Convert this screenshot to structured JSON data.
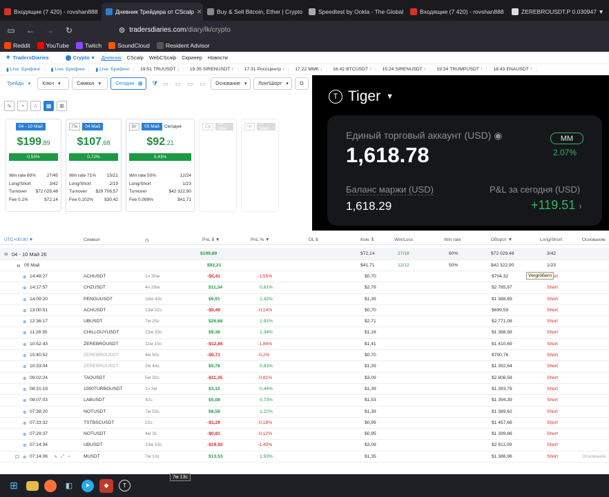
{
  "tabs": [
    {
      "label": "Входящие (7 420) - rovshan888",
      "color": "#d93025",
      "active": false
    },
    {
      "label": "Дневник Трейдера от CScalp",
      "color": "#2a7fd4",
      "active": true
    },
    {
      "label": "Buy & Sell Bitcoin, Ether | Crypto",
      "color": "#888",
      "active": false
    },
    {
      "label": "Speedtest by Ookla - The Global",
      "color": "#aaa",
      "active": false
    },
    {
      "label": "Входящие (7 420) - rovshan888",
      "color": "#d93025",
      "active": false
    },
    {
      "label": "ZEREBROUSDT.P 0.030947 ▼",
      "color": "#ddd",
      "active": false
    }
  ],
  "url": {
    "domain": "tradersdiaries.com",
    "path": "/diary/lk/crypto"
  },
  "bookmarks": [
    {
      "label": "Reddit",
      "color": "#ff4500"
    },
    {
      "label": "YouTube",
      "color": "#ff0000"
    },
    {
      "label": "Twitch",
      "color": "#9146ff"
    },
    {
      "label": "SoundCloud",
      "color": "#ff5500"
    },
    {
      "label": "Resident Advisor",
      "color": "#555"
    }
  ],
  "site": {
    "logo": "TradersDiaries",
    "market": "Crypto",
    "menu": [
      "Дневник",
      "CScalp",
      "WebCScalp",
      "Скринер",
      "Новости"
    ]
  },
  "ticker": [
    {
      "time": "Live: Брифинг",
      "name": "",
      "dir": "",
      "live": true
    },
    {
      "time": "Live: Брифинг",
      "name": "",
      "dir": "",
      "live": true
    },
    {
      "time": "Live: Брифинг",
      "name": "",
      "dir": "",
      "live": true
    },
    {
      "time": "19:51",
      "name": "TRUUSDT",
      "dir": "↓",
      "live": false
    },
    {
      "time": "19:35",
      "name": "SIRENUSDT",
      "dir": "↑",
      "live": false
    },
    {
      "time": "17:31",
      "name": "РоссЦентр",
      "dir": "↑",
      "live": false
    },
    {
      "time": "17:22",
      "name": "ММК",
      "dir": "↓",
      "live": false
    },
    {
      "time": "16:42",
      "name": "BTCUSDT",
      "dir": "↑",
      "live": false
    },
    {
      "time": "15:24",
      "name": "SIRENUSDT",
      "dir": "↑",
      "live": false
    },
    {
      "time": "19:34",
      "name": "TRUMPUSDT",
      "dir": "↑",
      "live": false
    },
    {
      "time": "18:43",
      "name": "ENAUSDT",
      "dir": "↑",
      "live": false
    }
  ],
  "filters": {
    "trades": "Трейды",
    "key": "Ключ",
    "symbol": "Символ",
    "today": "Сегодня",
    "basis": "Основание",
    "longshort": "Лонг\\Шорт",
    "other": "O"
  },
  "cards": [
    {
      "day": "",
      "date": "04 - 10 Май",
      "total": "$199",
      "cents": ",89",
      "pct": "0,55%",
      "win": "Win rate 60%",
      "wincnt": "27/45",
      "ls": "Long/Short",
      "lsv": "3/42",
      "turn": "Turnover",
      "turnv": "$72 029,48",
      "fee": "Fee 0,1%",
      "feev": "$72,14"
    },
    {
      "day": "Пн",
      "date": "04 Май",
      "total": "$107",
      "cents": ",68",
      "pct": "0,72%",
      "win": "Win rate 71%",
      "wincnt": "15/21",
      "ls": "Long/Short",
      "lsv": "2/19",
      "turn": "Turnover",
      "turnv": "$29 706,57",
      "fee": "Fee 0,102%",
      "feev": "$30,42"
    },
    {
      "day": "Вт",
      "date": "05 Май",
      "extra": "Сегодня",
      "total": "$92",
      "cents": ",21",
      "pct": "0,43%",
      "win": "Win rate 50%",
      "wincnt": "12/24",
      "ls": "Long/Short",
      "lsv": "1/23",
      "turn": "Turnover",
      "turnv": "$42 322,90",
      "fee": "Fee 0,099%",
      "feev": "$41,71"
    },
    {
      "day": "Ср",
      "date": "06 Май"
    },
    {
      "day": "Чт",
      "date": "07 Май"
    }
  ],
  "tiger": {
    "name": "Tiger",
    "label1": "Единый торговый аккаунт (USD)",
    "value1": "1,618.78",
    "mm": "MM",
    "pct": "2.07%",
    "label2": "Баланс маржи (USD)",
    "value2": "1,618.29",
    "label3": "P&L за сегодня (USD)",
    "value3": "+119.51"
  },
  "table": {
    "headers": {
      "tz": "UTC+00:00 ▼",
      "sym": "Символ",
      "pnl": "PnL $ ▼",
      "pnlp": "PnL % ▼",
      "dl": "DL $",
      "com": "Ком. $",
      "wl": "Win/Loss",
      "wr": "Win rate",
      "turn": "Оборот ▼",
      "ls": "Long/Short",
      "basis": "Основание"
    },
    "group1": {
      "label": "04 - 10 Май 26",
      "pnl": "$199,89",
      "com": "$72,14",
      "wl": "27/18",
      "wr": "60%",
      "turn": "$72 029,48",
      "ls": "3/42"
    },
    "group2": {
      "label": "05 Май",
      "pnl": "$92,21",
      "com": "$41,71",
      "wl": "12/12",
      "wr": "50%",
      "turn": "$42 322,90",
      "ls": "1/23"
    },
    "rows": [
      {
        "t": "14:48:27",
        "s": "ACHUSDT",
        "d": "1ч 30м",
        "p": "-$5,41",
        "pp": "-1,55%",
        "c": "$0,70",
        "o": "$704,32",
        "ls": "Short",
        "pos": false
      },
      {
        "t": "14:17:57",
        "s": "CHZUSDT",
        "d": "4ч 28м",
        "p": "$11,34",
        "pp": "0,81%",
        "c": "$2,79",
        "o": "$2 785,97",
        "ls": "Short",
        "pos": true
      },
      {
        "t": "14:09:20",
        "s": "PENGUUSDT",
        "d": "19м 43с",
        "p": "$9,91",
        "pp": "1,42%",
        "c": "$1,39",
        "o": "$1 388,69",
        "ls": "Short",
        "pos": true
      },
      {
        "t": "13:00:51",
        "s": "ACHUSDT",
        "d": "13м 32с",
        "p": "-$0,49",
        "pp": "-0,14%",
        "c": "$0,70",
        "o": "$699,59",
        "ls": "Short",
        "pos": false
      },
      {
        "t": "12:36:17",
        "s": "UBUSDT",
        "d": "7м 25с",
        "p": "$26,68",
        "pp": "1,91%",
        "c": "$2,71",
        "o": "$2 771,08",
        "ls": "Short",
        "pos": true
      },
      {
        "t": "11:28:35",
        "s": "CHILLGUYUSDT",
        "d": "23м 33с",
        "p": "$9,38",
        "pp": "1,34%",
        "c": "$1,16",
        "o": "$1 388,98",
        "ls": "Short",
        "pos": true
      },
      {
        "t": "10:52:43",
        "s": "ZEREBROUSDT",
        "d": "11м 15с",
        "p": "-$12,85",
        "pp": "-1,84%",
        "c": "$1,41",
        "o": "$1 410,69",
        "ls": "Short",
        "pos": false
      },
      {
        "t": "10:40:52",
        "s": "ZEREBROUSDT",
        "d": "4м 50с",
        "p": "-$0,71",
        "pp": "-0,2%",
        "c": "$0,70",
        "o": "$700,76",
        "ls": "Short",
        "pos": false,
        "dim": true
      },
      {
        "t": "10:33:04",
        "s": "ZEREBROUSDT",
        "d": "2м 44с",
        "p": "$5,78",
        "pp": "0,83%",
        "c": "$1,39",
        "o": "$1 392,64",
        "ls": "Short",
        "pos": true,
        "dim": true
      },
      {
        "t": "09:02:24",
        "s": "TAOUSDT",
        "d": "5м 30с",
        "p": "-$11,35",
        "pp": "-0,81%",
        "c": "$3,09",
        "o": "$2 806,58",
        "ls": "Short",
        "pos": false
      },
      {
        "t": "08:31:19",
        "s": "1000TURBOUSDT",
        "d": "1ч 3м",
        "p": "$3,10",
        "pp": "0,44%",
        "c": "$1,39",
        "o": "$1 393,78",
        "ls": "Short",
        "pos": true
      },
      {
        "t": "08:07:03",
        "s": "LABUSDT",
        "d": "42с",
        "p": "$5,08",
        "pp": "0,73%",
        "c": "$1,53",
        "o": "$1 394,39",
        "ls": "Short",
        "pos": true
      },
      {
        "t": "07:38:20",
        "s": "NOTUSDT",
        "d": "7м 53с",
        "p": "$8,56",
        "pp": "1,22%",
        "c": "$1,39",
        "o": "$1 389,62",
        "ls": "Short",
        "pos": true
      },
      {
        "t": "07:33:32",
        "s": "TSTBSCUSDT",
        "d": "22с",
        "p": "-$1,29",
        "pp": "-0,18%",
        "c": "$0,99",
        "o": "$1 457,68",
        "ls": "Short",
        "pos": false
      },
      {
        "t": "07:29:37",
        "s": "NOTUSDT",
        "d": "4м 3с",
        "p": "-$0,81",
        "pp": "-0,12%",
        "c": "$0,95",
        "o": "$1 399,86",
        "ls": "Short",
        "pos": false
      },
      {
        "t": "07:14:34",
        "s": "UBUSDT",
        "d": "23м 53с",
        "p": "-$19,92",
        "pp": "-1,43%",
        "c": "$3,09",
        "o": "$2 811,09",
        "ls": "Short",
        "pos": false
      },
      {
        "t": "07:14:06",
        "s": "MUSDT",
        "d": "7м 13с",
        "p": "$13,53",
        "pp": "1,93%",
        "c": "$1,35",
        "o": "$1 386,96",
        "ls": "Short",
        "pos": true,
        "basis": "Основание"
      }
    ]
  },
  "tooltip": "Vergrößern",
  "tooltip2": "7м 13с"
}
